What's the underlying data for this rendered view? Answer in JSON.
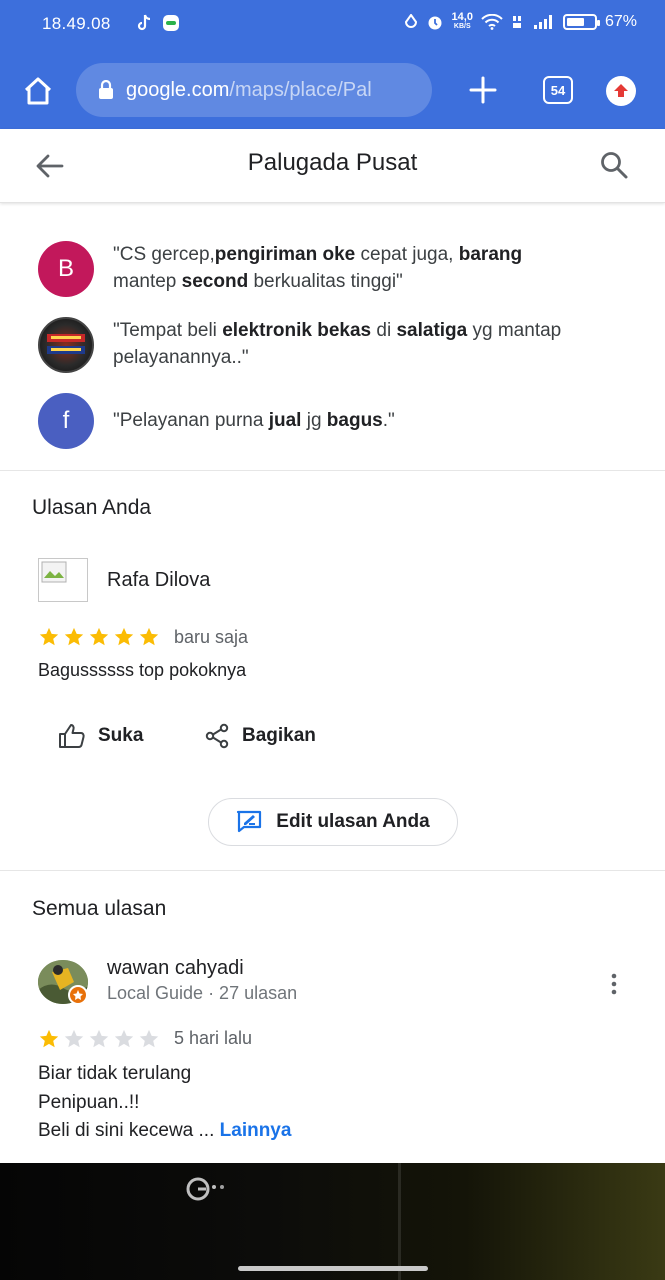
{
  "status_bar": {
    "time": "18.49.08",
    "net_speed_top": "14,0",
    "net_speed_bottom": "KB/S",
    "battery": "67%",
    "battery_level": 0.67
  },
  "browser": {
    "url_host": "google.com",
    "url_path": "/maps/place/Pal",
    "tab_count": "54"
  },
  "header": {
    "title": "Palugada Pusat"
  },
  "highlights": [
    {
      "avatar_letter": "B",
      "avatar_color": "#c2185b",
      "parts": [
        "\"CS gercep,",
        "pengiriman oke",
        " cepat juga, ",
        "barang",
        " mantep ",
        "second",
        " berkualitas tinggi\""
      ]
    },
    {
      "avatar_letter": "",
      "avatar_color": "#1a1a1a",
      "parts": [
        "\"Tempat beli ",
        "elektronik bekas",
        " di ",
        "salatiga",
        " yg mantap pelayanannya..\""
      ]
    },
    {
      "avatar_letter": "f",
      "avatar_color": "#4a5fc1",
      "parts": [
        "\"Pelayanan purna ",
        "jual",
        " jg ",
        "bagus",
        ".\""
      ]
    }
  ],
  "your_review": {
    "section_title": "Ulasan Anda",
    "author": "Rafa Dilova",
    "rating": 5,
    "time": "baru saja",
    "text": "Bagussssss top pokoknya",
    "like_label": "Suka",
    "share_label": "Bagikan",
    "edit_label": "Edit ulasan Anda"
  },
  "all_reviews": {
    "section_title": "Semua ulasan",
    "reviews": [
      {
        "author": "wawan cahyadi",
        "meta": "Local Guide · 27 ulasan",
        "rating": 1,
        "time": "5 hari lalu",
        "lines": [
          "Biar tidak terulang",
          "Penipuan..!!",
          "Beli di sini kecewa ... "
        ],
        "more_label": "Lainnya"
      }
    ]
  },
  "colors": {
    "browser_bar": "#3d6fdc",
    "star_filled": "#fbbc04",
    "star_empty": "#dadce0",
    "link": "#1a73e8"
  },
  "icons": [
    "home-icon",
    "lock-icon",
    "plus-icon",
    "tabs-icon",
    "update-icon",
    "back-arrow-icon",
    "search-icon",
    "thumbs-up-icon",
    "share-icon",
    "edit-review-icon",
    "more-vert-icon",
    "star-icon",
    "local-guide-badge-icon"
  ]
}
